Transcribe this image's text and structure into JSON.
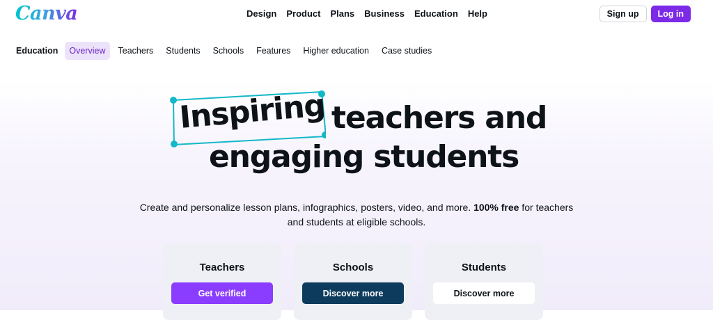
{
  "brand": {
    "logo_text": "Canva"
  },
  "nav": {
    "items": [
      "Design",
      "Product",
      "Plans",
      "Business",
      "Education",
      "Help"
    ],
    "signup_label": "Sign up",
    "login_label": "Log in"
  },
  "subnav": {
    "section": "Education",
    "items": [
      "Overview",
      "Teachers",
      "Students",
      "Schools",
      "Features",
      "Higher education",
      "Case studies"
    ],
    "active": "Overview"
  },
  "hero": {
    "highlight_word": "Inspiring",
    "title_rest_line1": "teachers and",
    "title_line2": "engaging students",
    "subtitle_part1": "Create and personalize lesson plans, infographics, posters, video, and more.",
    "subtitle_bold": "100% free",
    "subtitle_part2": "for teachers and students at eligible schools."
  },
  "cards": [
    {
      "title": "Teachers",
      "button": "Get verified"
    },
    {
      "title": "Schools",
      "button": "Discover more"
    },
    {
      "title": "Students",
      "button": "Discover more"
    }
  ],
  "colors": {
    "accent": "#7d2ae8",
    "frame": "#13b8c8",
    "navy": "#0c3b5e"
  }
}
